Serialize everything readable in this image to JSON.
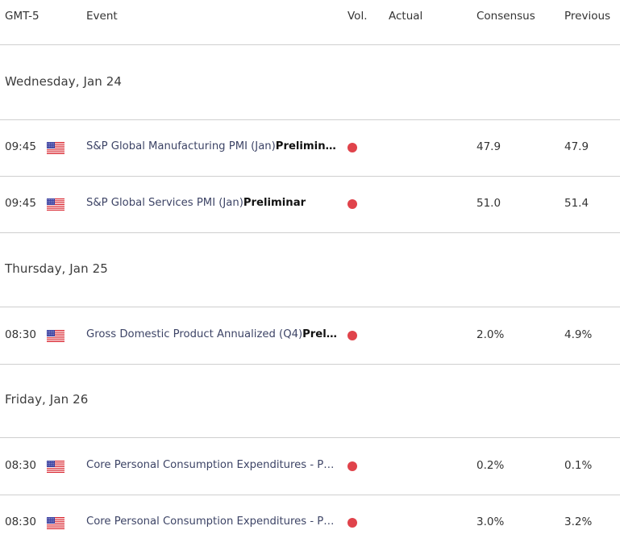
{
  "header": {
    "timezone": "GMT-5",
    "event": "Event",
    "vol": "Vol.",
    "actual": "Actual",
    "consensus": "Consensus",
    "previous": "Previous"
  },
  "colors": {
    "impact_high": "#e0434b",
    "divider": "#cfcfcf",
    "event_text": "#3d4466"
  },
  "days": [
    {
      "label": "Wednesday, Jan 24",
      "events": [
        {
          "time": "09:45",
          "country": "us-flag-icon",
          "name": "S&P Global Manufacturing PMI (Jan)",
          "suffix": "Prelimin…",
          "impact": "high",
          "actual": "",
          "consensus": "47.9",
          "previous": "47.9"
        },
        {
          "time": "09:45",
          "country": "us-flag-icon",
          "name": "S&P Global Services PMI (Jan)",
          "suffix": "Preliminar",
          "impact": "high",
          "actual": "",
          "consensus": "51.0",
          "previous": "51.4"
        }
      ]
    },
    {
      "label": "Thursday, Jan 25",
      "events": [
        {
          "time": "08:30",
          "country": "us-flag-icon",
          "name": "Gross Domestic Product Annualized (Q4)",
          "suffix": "Prel…",
          "impact": "high",
          "actual": "",
          "consensus": "2.0%",
          "previous": "4.9%"
        }
      ]
    },
    {
      "label": "Friday, Jan 26",
      "events": [
        {
          "time": "08:30",
          "country": "us-flag-icon",
          "name": "Core Personal Consumption Expenditures - P…",
          "suffix": "",
          "impact": "high",
          "actual": "",
          "consensus": "0.2%",
          "previous": "0.1%"
        },
        {
          "time": "08:30",
          "country": "us-flag-icon",
          "name": "Core Personal Consumption Expenditures - P…",
          "suffix": "",
          "impact": "high",
          "actual": "",
          "consensus": "3.0%",
          "previous": "3.2%"
        }
      ]
    }
  ]
}
